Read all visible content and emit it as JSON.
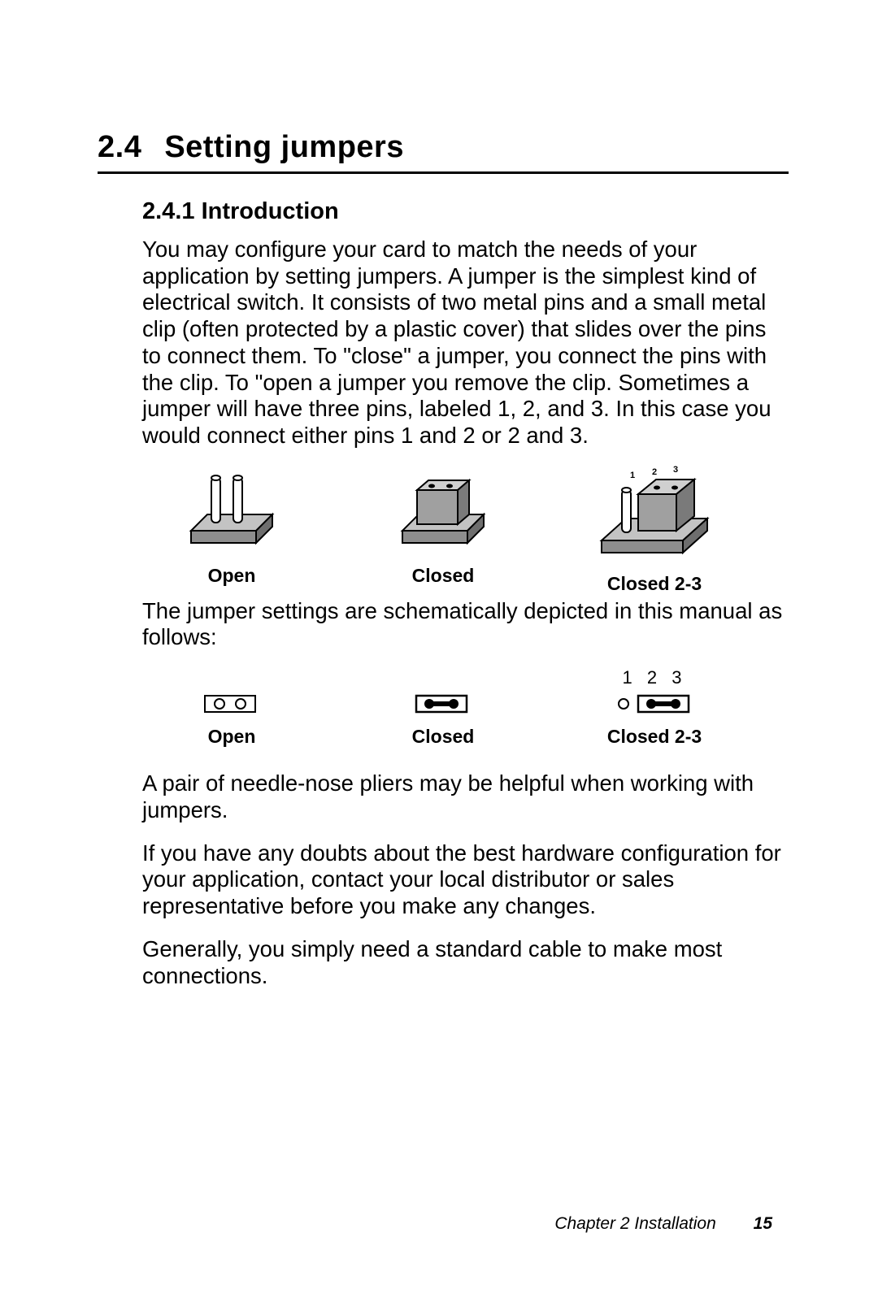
{
  "section": {
    "number": "2.4",
    "title": "Setting jumpers"
  },
  "subsection": {
    "number": "2.4.1",
    "title": "Introduction"
  },
  "paragraphs": {
    "p1": "You may configure your card to match the needs of your application by setting jumpers. A jumper is the simplest kind of electrical switch. It consists of two metal pins and a small metal clip (often protected by a plastic cover) that slides over the pins to connect them. To \"close\" a jumper, you connect the pins with the clip. To \"open  a jumper you remove the clip. Sometimes a jumper will have three pins, labeled 1, 2, and 3. In this case you would connect either pins 1 and 2 or 2 and 3.",
    "p2": "The jumper settings are schematically depicted in this manual as follows:",
    "p3": "A pair of needle-nose pliers may be helpful when working with jumpers.",
    "p4": "If you have any doubts about the best hardware configuration for your application, contact your local distributor or sales representative before you make any changes.",
    "p5": "Generally, you simply need a standard cable to make most connections."
  },
  "fig_labels": {
    "open": "Open",
    "closed": "Closed",
    "closed23": "Closed 2-3",
    "pin_numbers_3d": {
      "p1": "1",
      "p2": "2",
      "p3": "3"
    },
    "pin_numbers_sch": "1  2  3"
  },
  "footer": {
    "chapter": "Chapter 2   Installation",
    "page": "15"
  }
}
